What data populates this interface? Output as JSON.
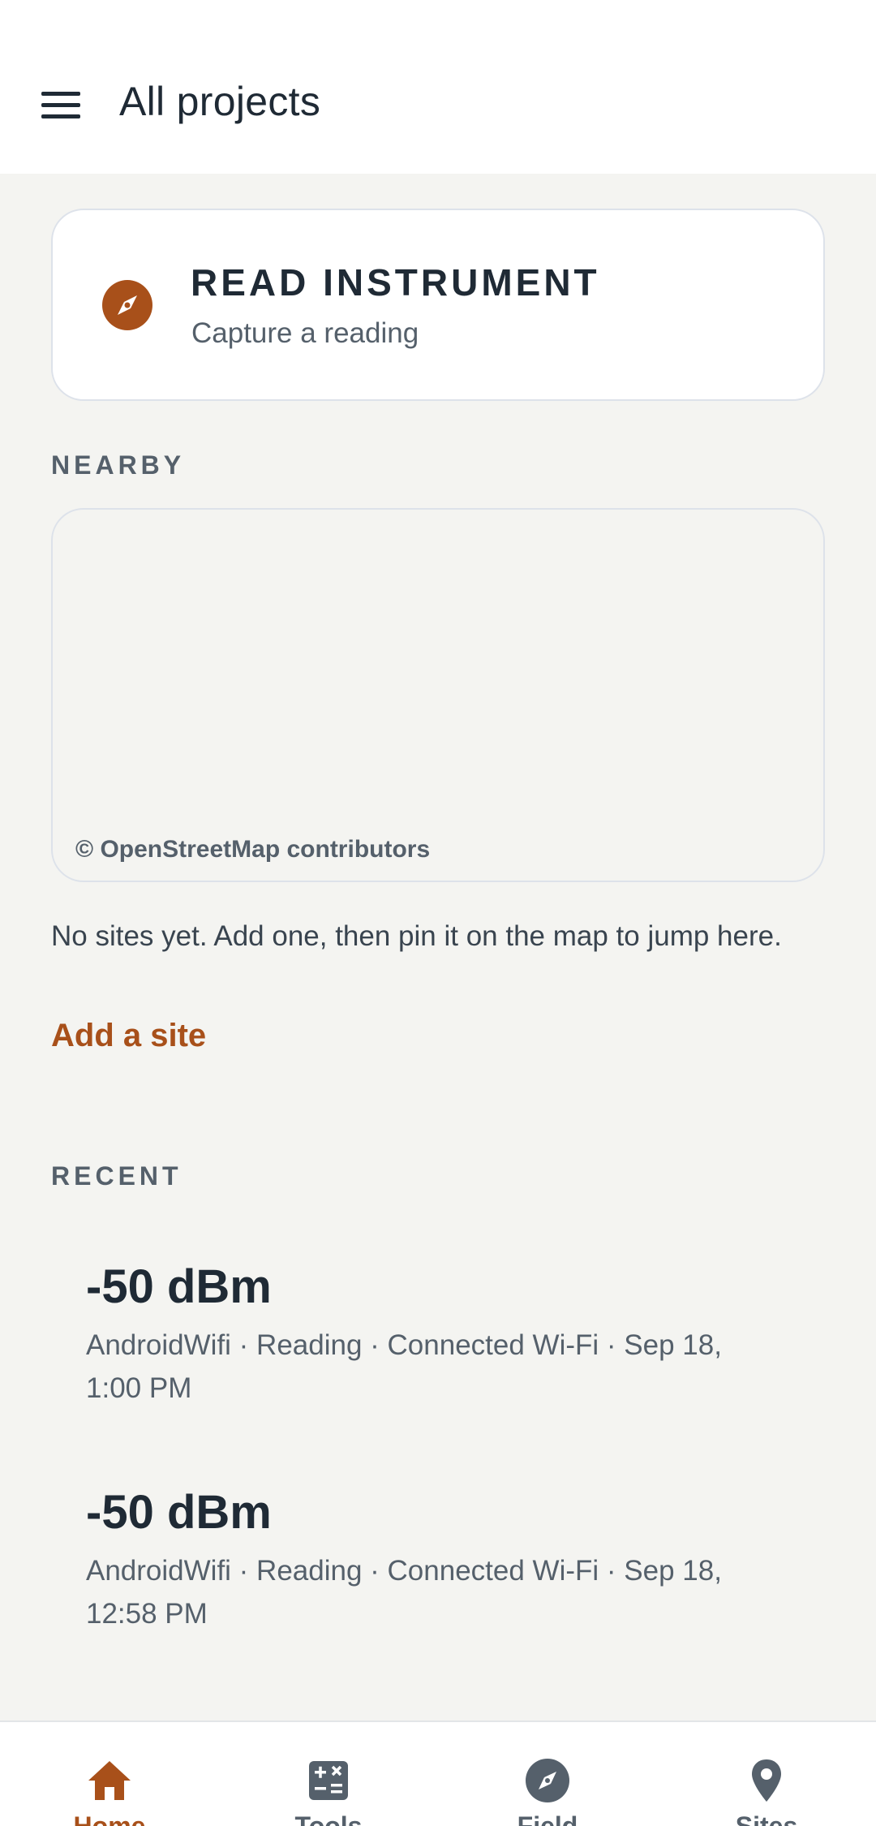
{
  "app_bar": {
    "menu_icon": "hamburger-menu-icon",
    "title": "All projects"
  },
  "read_card": {
    "icon": "compass-icon",
    "title": "READ INSTRUMENT",
    "subtitle": "Capture a reading"
  },
  "nearby": {
    "section_label": "NEARBY",
    "map_attribution": "© OpenStreetMap contributors",
    "empty_message": "No sites yet. Add one, then pin it on the map to jump here.",
    "add_site_label": "Add a site"
  },
  "recent": {
    "section_label": "RECENT",
    "items": [
      {
        "value": "-50 dBm",
        "meta_line1": "AndroidWifi · Reading · Connected Wi-Fi · Sep 18,",
        "meta_line2": "1:00 PM"
      },
      {
        "value": "-50 dBm",
        "meta_line1": "AndroidWifi · Reading · Connected Wi-Fi · Sep 18,",
        "meta_line2": "12:58 PM"
      }
    ]
  },
  "bottom_nav": {
    "items": [
      {
        "label": "Home",
        "icon": "home-icon",
        "active": true
      },
      {
        "label": "Tools",
        "icon": "calculator-icon",
        "active": false
      },
      {
        "label": "Field",
        "icon": "compass-icon",
        "active": false
      },
      {
        "label": "Sites",
        "icon": "map-pin-icon",
        "active": false
      }
    ]
  },
  "colors": {
    "accent": "#a8501a",
    "background": "#f4f4f1",
    "surface": "#ffffff",
    "text_primary": "#1f2a35",
    "text_secondary": "#55606b"
  }
}
